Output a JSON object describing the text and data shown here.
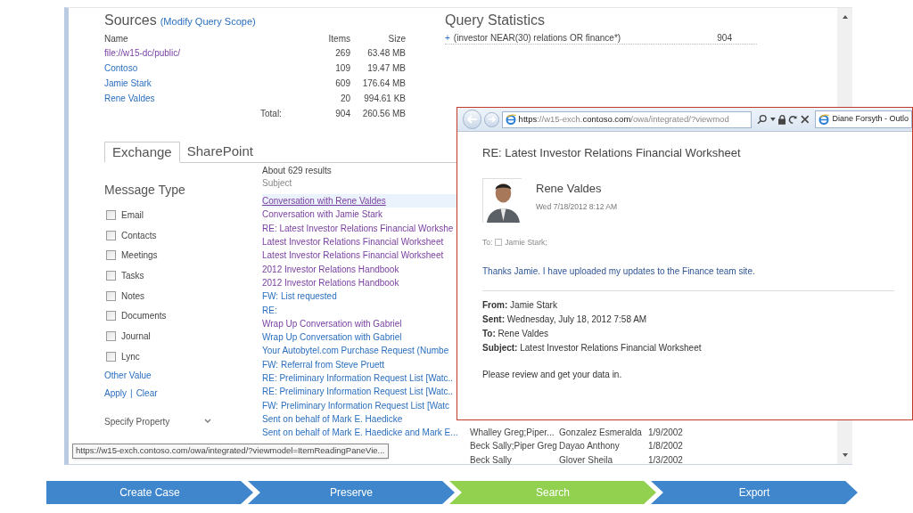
{
  "sources": {
    "title": "Sources",
    "link": "(Modify Query Scope)",
    "columns": [
      "Name",
      "Items",
      "Size"
    ],
    "rows": [
      {
        "name": "file://w15-dc/public/",
        "visited": true,
        "items": "269",
        "size": "63.48 MB"
      },
      {
        "name": "Contoso",
        "visited": false,
        "items": "109",
        "size": "19.47 MB"
      },
      {
        "name": "Jamie Stark",
        "visited": false,
        "items": "609",
        "size": "176.64 MB"
      },
      {
        "name": "Rene Valdes",
        "visited": false,
        "items": "20",
        "size": "994.61 KB"
      }
    ],
    "total": {
      "label": "Total:",
      "items": "904",
      "size": "260.56 MB"
    }
  },
  "query_statistics": {
    "title": "Query Statistics",
    "rows": [
      {
        "expander": "+",
        "query": "(investor NEAR(30) relations OR finance*)",
        "count": "904"
      }
    ]
  },
  "tabs": [
    {
      "label": "Exchange",
      "selected": true
    },
    {
      "label": "SharePoint",
      "selected": false
    }
  ],
  "refiners": {
    "title": "Message Type",
    "options": [
      {
        "label": "Email",
        "checked": false
      },
      {
        "label": "Contacts",
        "checked": false
      },
      {
        "label": "Meetings",
        "checked": false
      },
      {
        "label": "Tasks",
        "checked": false
      },
      {
        "label": "Notes",
        "checked": false
      },
      {
        "label": "Documents",
        "checked": false
      },
      {
        "label": "Journal",
        "checked": false
      },
      {
        "label": "Lync",
        "checked": false
      }
    ],
    "other_value": "Other Value",
    "apply": "Apply",
    "separator": "|",
    "clear": "Clear",
    "property_select": "Specify Property"
  },
  "results": {
    "count": "About 629 results",
    "column": "Subject",
    "rows": [
      {
        "subject": "Conversation with Rene Valdes",
        "visited": true,
        "selected": true
      },
      {
        "subject": "Conversation with Jamie Stark",
        "visited": true,
        "selected": false
      },
      {
        "subject": "RE: Latest Investor Relations Financial Workshe",
        "visited": true,
        "selected": false
      },
      {
        "subject": "Latest Investor Relations Financial Worksheet",
        "visited": true,
        "selected": false
      },
      {
        "subject": "Latest Investor Relations Financial Worksheet",
        "visited": true,
        "selected": false
      },
      {
        "subject": "2012 Investor Relations Handbook",
        "visited": true,
        "selected": false
      },
      {
        "subject": "2012 Investor Relations Handbook",
        "visited": true,
        "selected": false
      },
      {
        "subject": "FW: List requested",
        "visited": false,
        "selected": false
      },
      {
        "subject": "RE:",
        "visited": false,
        "selected": false
      },
      {
        "subject": "Wrap Up Conversation with Gabriel",
        "visited": true,
        "selected": false
      },
      {
        "subject": "Wrap Up Conversation with Gabriel",
        "visited": false,
        "selected": false
      },
      {
        "subject": "Your Autobytel.com Purchase Request (Numbe",
        "visited": false,
        "selected": false
      },
      {
        "subject": "FW: Referral from Steve Pruett",
        "visited": false,
        "selected": false
      },
      {
        "subject": "RE: Preliminary Information Request List [Watc..",
        "visited": false,
        "selected": false
      },
      {
        "subject": "RE: Preliminary Information Request List [Watc..",
        "visited": false,
        "selected": false
      },
      {
        "subject": "FW: Preliminary Information Request List [Watc",
        "visited": false,
        "selected": false
      },
      {
        "subject": "Sent on behalf of Mark E. Haedicke",
        "visited": false,
        "selected": false
      },
      {
        "subject": "Sent on behalf of Mark E. Haedicke and Mark E...",
        "visited": false,
        "selected": false,
        "from": "Whalley Greg;Piper...",
        "to": "Gonzalez Esmeralda",
        "date": "1/9/2002"
      },
      {
        "selected": false,
        "from": "Beck Sally;Piper Greg",
        "to": "Dayao Anthony",
        "date": "1/8/2002"
      },
      {
        "selected": false,
        "from": "Beck Sally",
        "to": "Glover Sheila",
        "date": "1/3/2002"
      }
    ]
  },
  "status_tooltip": "https://w15-exch.contoso.com/owa/integrated/?viewmodel=ItemReadingPaneVie...",
  "popup": {
    "address": {
      "scheme": "https",
      "host_start": "://w15-exch.",
      "domain": "contoso.com",
      "path": "/owa/integrated/?viewmod"
    },
    "tab": "Diane Forsyth - Outlo",
    "subject": "RE: Latest Investor Relations Financial Worksheet",
    "sender": "Rene Valdes",
    "sent": "Wed 7/18/2012 8:12 AM",
    "to_label": "To:",
    "to": "Jamie Stark;",
    "body": "Thanks Jamie. I have uploaded my updates to the Finance team site.",
    "quoted_header": [
      "**From:** Jamie Stark",
      "**Sent:** Wednesday, July 18, 2012 7:58 AM",
      "**To:** Rene Valdes",
      "**Subject:** Latest Investor Relations Financial Worksheet"
    ],
    "quoted_body": "Please review and get your data in."
  },
  "process": [
    {
      "label": "Create Case",
      "selected": false
    },
    {
      "label": "Preserve",
      "selected": false
    },
    {
      "label": "Search",
      "selected": true
    },
    {
      "label": "Export",
      "selected": false
    }
  ]
}
